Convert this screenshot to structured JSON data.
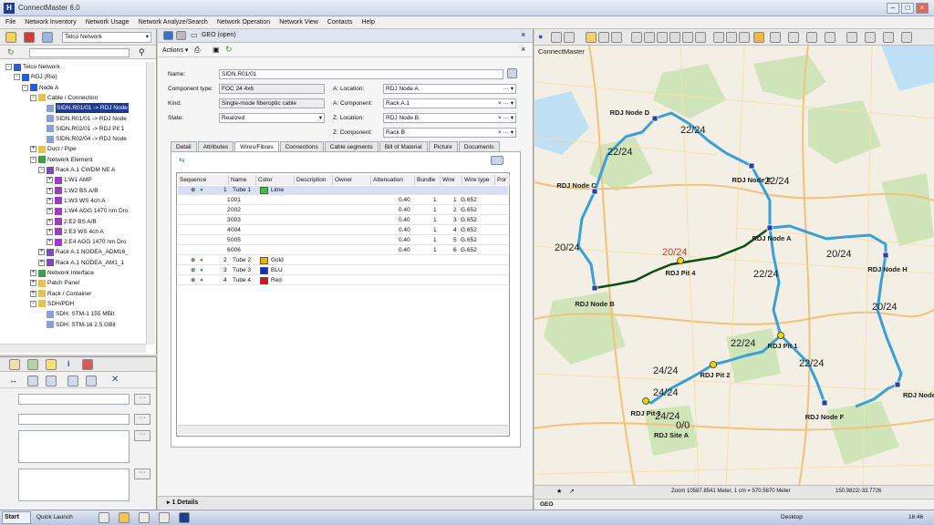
{
  "app": {
    "title": "ConnectMaster 6.0"
  },
  "menu": [
    "File",
    "Network Inventory",
    "Network Usage",
    "Network Analyze/Search",
    "Network Operation",
    "Network View",
    "Contacts",
    "Help"
  ],
  "left_toolbar": {
    "dropdown": "Telco Network"
  },
  "tree": [
    {
      "label": "Telco Network",
      "depth": 0,
      "toggle": "-",
      "icon": "network"
    },
    {
      "label": "RDJ (Rio)",
      "depth": 1,
      "toggle": "-",
      "icon": "house"
    },
    {
      "label": "Node A",
      "depth": 2,
      "toggle": "-",
      "icon": "house"
    },
    {
      "label": "Cable / Connection",
      "depth": 3,
      "toggle": "-",
      "icon": "folder"
    },
    {
      "label": "SIDN.R01/01 -> RDJ Node",
      "depth": 4,
      "toggle": "",
      "icon": "cable",
      "selected": true
    },
    {
      "label": "SIDN.R01/01 -> RDJ Node",
      "depth": 4,
      "toggle": "",
      "icon": "cable"
    },
    {
      "label": "SIDN.R02/01 -> RDJ Pit 1",
      "depth": 4,
      "toggle": "",
      "icon": "cable"
    },
    {
      "label": "SIDN.R02/04 -> RDJ Node",
      "depth": 4,
      "toggle": "",
      "icon": "cable"
    },
    {
      "label": "Duct / Pipe",
      "depth": 3,
      "toggle": "+",
      "icon": "folder"
    },
    {
      "label": "Network Element",
      "depth": 3,
      "toggle": "-",
      "icon": "element"
    },
    {
      "label": "Rack A.1 CWDM NE A",
      "depth": 4,
      "toggle": "-",
      "icon": "rack"
    },
    {
      "label": "1:W1 AMP",
      "depth": 5,
      "toggle": "+",
      "icon": "card"
    },
    {
      "label": "1:W2 BS A/B",
      "depth": 5,
      "toggle": "+",
      "icon": "card"
    },
    {
      "label": "1:W3 WS 4ch A",
      "depth": 5,
      "toggle": "+",
      "icon": "card"
    },
    {
      "label": "1:W4 AGG 1470 nm Dro",
      "depth": 5,
      "toggle": "+",
      "icon": "card"
    },
    {
      "label": "2:E2 BS A/B",
      "depth": 5,
      "toggle": "+",
      "icon": "card"
    },
    {
      "label": "2:E3 WS 4ch A",
      "depth": 5,
      "toggle": "+",
      "icon": "card"
    },
    {
      "label": "2:E4 AGG 1470 nm Dro",
      "depth": 5,
      "toggle": "+",
      "icon": "card"
    },
    {
      "label": "Rack A.1 NODEA_ADM16_",
      "depth": 4,
      "toggle": "+",
      "icon": "rack"
    },
    {
      "label": "Rack A.1 NODEA_AM1_1",
      "depth": 4,
      "toggle": "+",
      "icon": "rack"
    },
    {
      "label": "Network Interface",
      "depth": 3,
      "toggle": "+",
      "icon": "element"
    },
    {
      "label": "Patch Panel",
      "depth": 3,
      "toggle": "+",
      "icon": "folder"
    },
    {
      "label": "Rack / Container",
      "depth": 3,
      "toggle": "+",
      "icon": "folder"
    },
    {
      "label": "SDH/PDH",
      "depth": 3,
      "toggle": "-",
      "icon": "folder"
    },
    {
      "label": "SDH: STM-1 155 MBit",
      "depth": 4,
      "toggle": "",
      "icon": "cable"
    },
    {
      "label": "SDH: STM-16 2.5 GBit",
      "depth": 4,
      "toggle": "",
      "icon": "cable"
    }
  ],
  "center": {
    "tab_label": "GEO (open)",
    "actions_label": "Actions",
    "form": {
      "name_label": "Name:",
      "name": "SIDN.R01/01",
      "type_label": "Component type:",
      "type": "FOC 24 4x6",
      "kind_label": "Kind:",
      "kind": "Single-mode fiberoptic cable",
      "state_label": "State:",
      "state": "Realized",
      "a_loc_label": "A: Location:",
      "a_loc": "RDJ Node A",
      "a_comp_label": "A: Component:",
      "a_comp": "Rack A.1",
      "z_loc_label": "Z: Location:",
      "z_loc": "RDJ Node B",
      "z_comp_label": "Z: Component:",
      "z_comp": "Rack B"
    },
    "tabs": [
      "Detail",
      "Attributes",
      "Wires/Fibres",
      "Connections",
      "Cable segments",
      "Bill of Material",
      "Picture",
      "Documents"
    ],
    "active_tab": "Wires/Fibres",
    "grid_headers": [
      "Sequence",
      "Name",
      "Color",
      "Description",
      "Owner",
      "Attenuation",
      "Bundle",
      "Wire",
      "Wire type",
      "Por"
    ],
    "grid_rows": [
      {
        "seq": "1",
        "name": "Tube 1",
        "color": "Lime",
        "swatch": "#33cc33",
        "att": "",
        "bundle": "",
        "wire": "",
        "type": "",
        "level": 0,
        "sel": true
      },
      {
        "seq": "1",
        "name": "001",
        "color": "",
        "swatch": "",
        "att": "0.40",
        "bundle": "1",
        "wire": "1",
        "type": "G.652",
        "level": 1
      },
      {
        "seq": "2",
        "name": "002",
        "color": "",
        "swatch": "",
        "att": "0.40",
        "bundle": "1",
        "wire": "2",
        "type": "G.652",
        "level": 1
      },
      {
        "seq": "3",
        "name": "003",
        "color": "",
        "swatch": "",
        "att": "0.40",
        "bundle": "1",
        "wire": "3",
        "type": "G.652",
        "level": 1
      },
      {
        "seq": "4",
        "name": "004",
        "color": "",
        "swatch": "",
        "att": "0.40",
        "bundle": "1",
        "wire": "4",
        "type": "G.652",
        "level": 1
      },
      {
        "seq": "5",
        "name": "005",
        "color": "",
        "swatch": "",
        "att": "0.40",
        "bundle": "1",
        "wire": "5",
        "type": "G.652",
        "level": 1
      },
      {
        "seq": "6",
        "name": "006",
        "color": "",
        "swatch": "",
        "att": "0.40",
        "bundle": "1",
        "wire": "6",
        "type": "G.652",
        "level": 1
      },
      {
        "seq": "2",
        "name": "Tube 2",
        "color": "Gold",
        "swatch": "#e8b400",
        "att": "",
        "bundle": "",
        "wire": "",
        "type": "",
        "level": 0
      },
      {
        "seq": "3",
        "name": "Tube 3",
        "color": "BLU",
        "swatch": "#1030c0",
        "att": "",
        "bundle": "",
        "wire": "",
        "type": "",
        "level": 0
      },
      {
        "seq": "4",
        "name": "Tube 4",
        "color": "Red",
        "swatch": "#dd1111",
        "att": "",
        "bundle": "",
        "wire": "",
        "type": "",
        "level": 0
      }
    ],
    "details_tab": "1 Details"
  },
  "map": {
    "title": "ConnectMaster",
    "nodes": [
      {
        "name": "RDJ Node D",
        "kind": "node"
      },
      {
        "name": "RDJ Node E",
        "kind": "node"
      },
      {
        "name": "RDJ Node C",
        "kind": "node"
      },
      {
        "name": "RDJ Node A",
        "kind": "node"
      },
      {
        "name": "RDJ Node B",
        "kind": "node"
      },
      {
        "name": "RDJ Pit 4",
        "kind": "pit"
      },
      {
        "name": "RDJ Node H",
        "kind": "node"
      },
      {
        "name": "RDJ Pit 1",
        "kind": "pit"
      },
      {
        "name": "RDJ Pit 2",
        "kind": "pit"
      },
      {
        "name": "RDJ Pit 3",
        "kind": "pit"
      },
      {
        "name": "RDJ Node F",
        "kind": "node"
      },
      {
        "name": "RDJ Node G",
        "kind": "node"
      },
      {
        "name": "RDJ Site A",
        "kind": "site"
      }
    ],
    "capacity_labels": [
      "22/24",
      "22/24",
      "22/24",
      "20/24",
      "20/24",
      "20/24",
      "22/24",
      "20/24",
      "24/24",
      "22/24",
      "24/24",
      "22/24",
      "24/24",
      "0/0"
    ],
    "status_zoom": "Zoom 10587.8541 Meter, 1 cm = 570.5670 Meter",
    "status_coords": "150.9822/-33.7726",
    "footer": "GEO"
  },
  "taskbar": {
    "start": "Start",
    "quick_launch": "Quick Launch",
    "desktop": "Desktop",
    "clock": "16:46"
  }
}
